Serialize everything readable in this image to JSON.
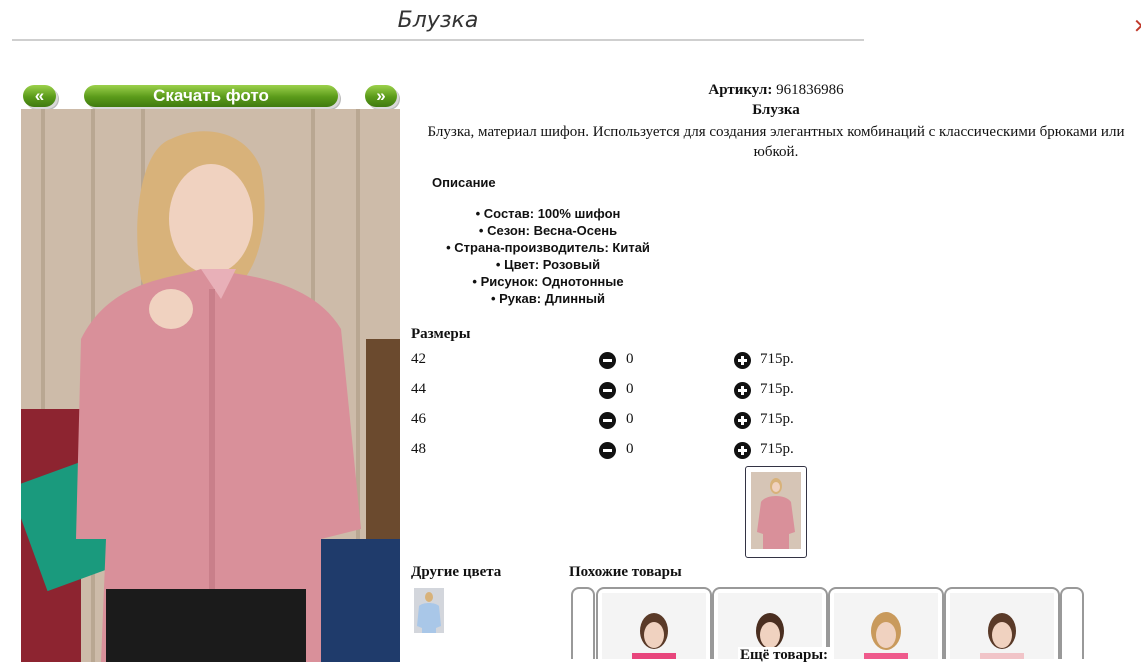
{
  "header": {
    "title": "Блузка",
    "close_icon": "close-icon"
  },
  "photo_nav": {
    "prev_label": "«",
    "download_label": "Скачать фото",
    "next_label": "»"
  },
  "product": {
    "article_label": "Артикул:",
    "article_value": "961836986",
    "name": "Блузка",
    "description": "Блузка, материал шифон. Используется для создания элегантных комбинаций с классическими брюками или юбкой."
  },
  "details": {
    "heading": "Описание",
    "items": [
      "Состав: 100% шифон",
      "Сезон: Весна-Осень",
      "Страна-производитель: Китай",
      "Цвет: Розовый",
      "Рисунок: Однотонные",
      "Рукав: Длинный"
    ]
  },
  "sizes": {
    "heading": "Размеры",
    "rows": [
      {
        "size": "42",
        "qty": "0",
        "price": "715р."
      },
      {
        "size": "44",
        "qty": "0",
        "price": "715р."
      },
      {
        "size": "46",
        "qty": "0",
        "price": "715р."
      },
      {
        "size": "48",
        "qty": "0",
        "price": "715р."
      }
    ]
  },
  "other_colors": {
    "heading": "Другие цвета"
  },
  "similar": {
    "heading": "Похожие товары",
    "more_label": "Ещё товары:"
  },
  "colors": {
    "accent_green": "#5a9a1a",
    "blouse_pink": "#d9909a",
    "close_red": "#c0392b"
  }
}
